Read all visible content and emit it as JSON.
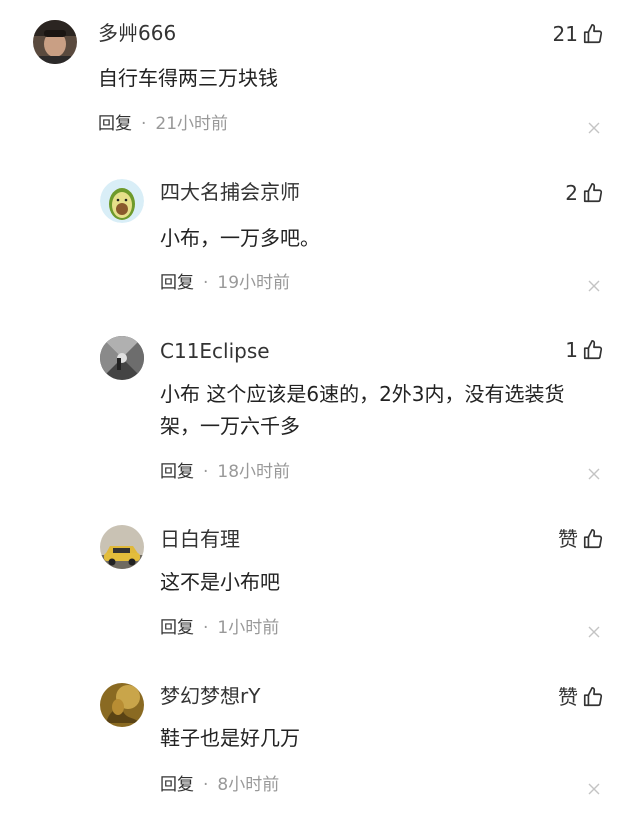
{
  "comments": [
    {
      "user": "多艸666",
      "likes": "21",
      "text": "自行车得两三万块钱",
      "reply_label": "回复",
      "time": "21小时前"
    },
    {
      "user": "四大名捕会京师",
      "likes": "2",
      "text": "小布，一万多吧。",
      "reply_label": "回复",
      "time": "19小时前"
    },
    {
      "user": "C11Eclipse",
      "likes": "1",
      "text": "小布 这个应该是6速的，2外3内，没有选装货架，一万六千多",
      "reply_label": "回复",
      "time": "18小时前"
    },
    {
      "user": "日白有理",
      "likes": "赞",
      "text": "这不是小布吧",
      "reply_label": "回复",
      "time": "1小时前"
    },
    {
      "user": "梦幻梦想rY",
      "likes": "赞",
      "text": "鞋子也是好几万",
      "reply_label": "回复",
      "time": "8小时前"
    }
  ],
  "icons": {
    "like": "thumbs-up-icon",
    "dismiss": "close-icon"
  },
  "colors": {
    "text": "#222222",
    "muted": "#999999"
  }
}
